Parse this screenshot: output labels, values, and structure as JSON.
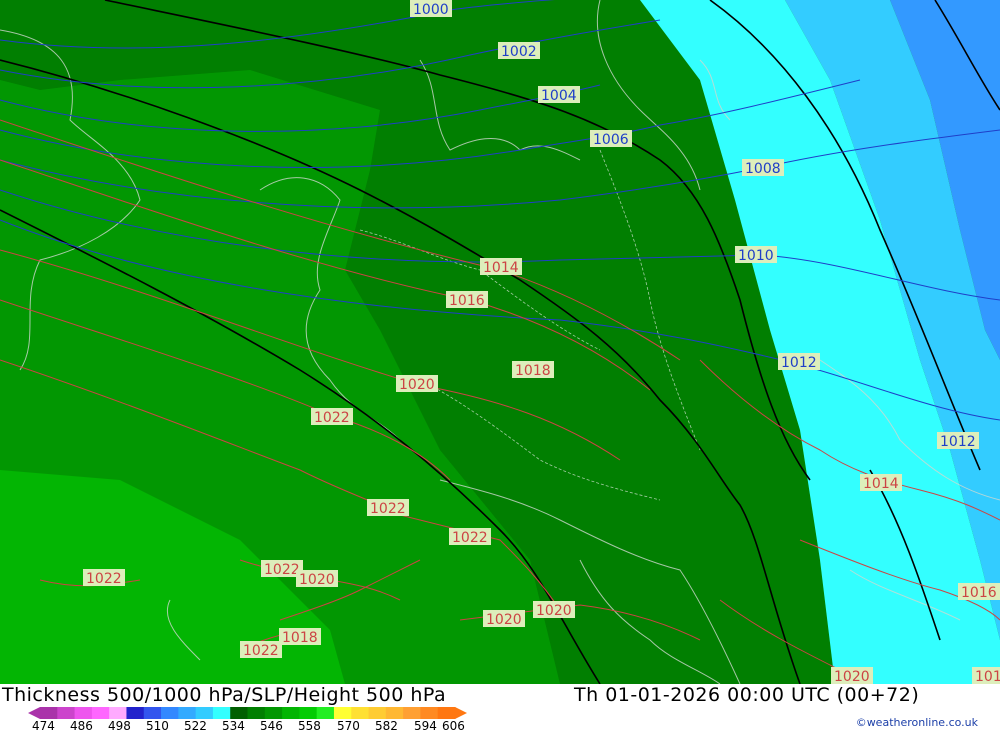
{
  "map": {
    "pressure_labels": [
      {
        "text": "1000",
        "kind": "blue"
      },
      {
        "text": "1002",
        "kind": "blue"
      },
      {
        "text": "1004",
        "kind": "blue"
      },
      {
        "text": "1006",
        "kind": "blue"
      },
      {
        "text": "1008",
        "kind": "blue"
      },
      {
        "text": "1010",
        "kind": "blue"
      },
      {
        "text": "1012",
        "kind": "blue"
      },
      {
        "text": "1012",
        "kind": "blue"
      },
      {
        "text": "1014",
        "kind": "red"
      },
      {
        "text": "1016",
        "kind": "red"
      },
      {
        "text": "1018",
        "kind": "red"
      },
      {
        "text": "1020",
        "kind": "red"
      },
      {
        "text": "1022",
        "kind": "red"
      },
      {
        "text": "1022",
        "kind": "red"
      },
      {
        "text": "1022",
        "kind": "red"
      },
      {
        "text": "1022",
        "kind": "red"
      },
      {
        "text": "1022",
        "kind": "red"
      },
      {
        "text": "1020",
        "kind": "red"
      },
      {
        "text": "1018",
        "kind": "red"
      },
      {
        "text": "1022",
        "kind": "red"
      },
      {
        "text": "1020",
        "kind": "red"
      },
      {
        "text": "1020",
        "kind": "red"
      },
      {
        "text": "1014",
        "kind": "red"
      },
      {
        "text": "1016",
        "kind": "red"
      },
      {
        "text": "1020",
        "kind": "red"
      },
      {
        "text": "101",
        "kind": "red"
      }
    ],
    "colors": {
      "green_dark": "#017f01",
      "green_mid": "#029702",
      "green_light": "#03b503",
      "cyan": "#33ffff",
      "sky": "#33ccff",
      "blue": "#3399ff",
      "isobar_blue": "#1f3fc8",
      "isobar_red": "#cc4444",
      "label_bg": "#ddeebb"
    }
  },
  "footer": {
    "title": "Thickness 500/1000 hPa/SLP/Height 500 hPa",
    "valid_time": "Th 01-01-2026 00:00 UTC (00+72)",
    "credit": "©weatheronline.co.uk",
    "scale_ticks": [
      "474",
      "486",
      "498",
      "510",
      "522",
      "534",
      "546",
      "558",
      "570",
      "582",
      "594",
      "606"
    ],
    "scale_colors": [
      "#aa33aa",
      "#cc44cc",
      "#ee55ee",
      "#ff66ff",
      "#ffaaff",
      "#2222cc",
      "#3355ee",
      "#3388ff",
      "#33aaff",
      "#33ccff",
      "#33ffff",
      "#015f01",
      "#017f01",
      "#029702",
      "#03b503",
      "#04cc04",
      "#22ee22",
      "#ffff33",
      "#ffe033",
      "#ffcc33",
      "#ffb833",
      "#ffa033",
      "#ff8a22",
      "#ff7711"
    ]
  }
}
